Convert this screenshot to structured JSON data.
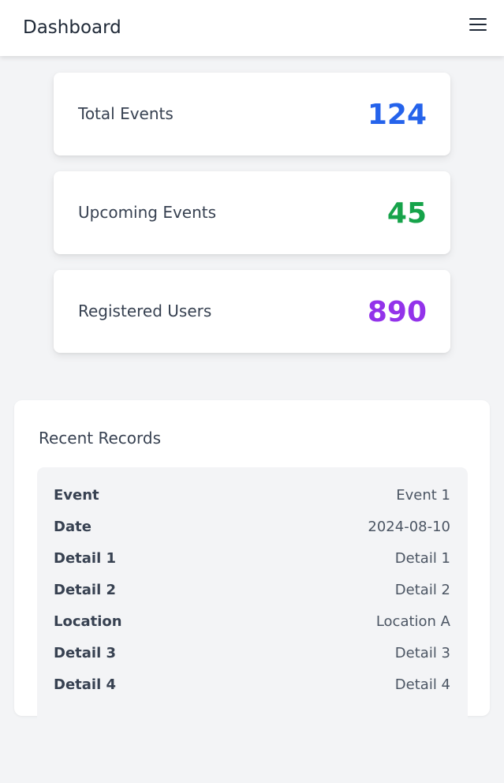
{
  "header": {
    "title": "Dashboard",
    "menu_icon": "hamburger-menu-icon"
  },
  "stats": [
    {
      "label": "Total Events",
      "value": "124",
      "color": "#2563eb"
    },
    {
      "label": "Upcoming Events",
      "value": "45",
      "color": "#16a34a"
    },
    {
      "label": "Registered Users",
      "value": "890",
      "color": "#9333ea"
    }
  ],
  "records": {
    "title": "Recent Records",
    "rows": [
      {
        "key": "Event",
        "value": "Event 1"
      },
      {
        "key": "Date",
        "value": "2024-08-10"
      },
      {
        "key": "Detail 1",
        "value": "Detail 1"
      },
      {
        "key": "Detail 2",
        "value": "Detail 2"
      },
      {
        "key": "Location",
        "value": "Location A"
      },
      {
        "key": "Detail 3",
        "value": "Detail 3"
      },
      {
        "key": "Detail 4",
        "value": "Detail 4"
      }
    ]
  }
}
